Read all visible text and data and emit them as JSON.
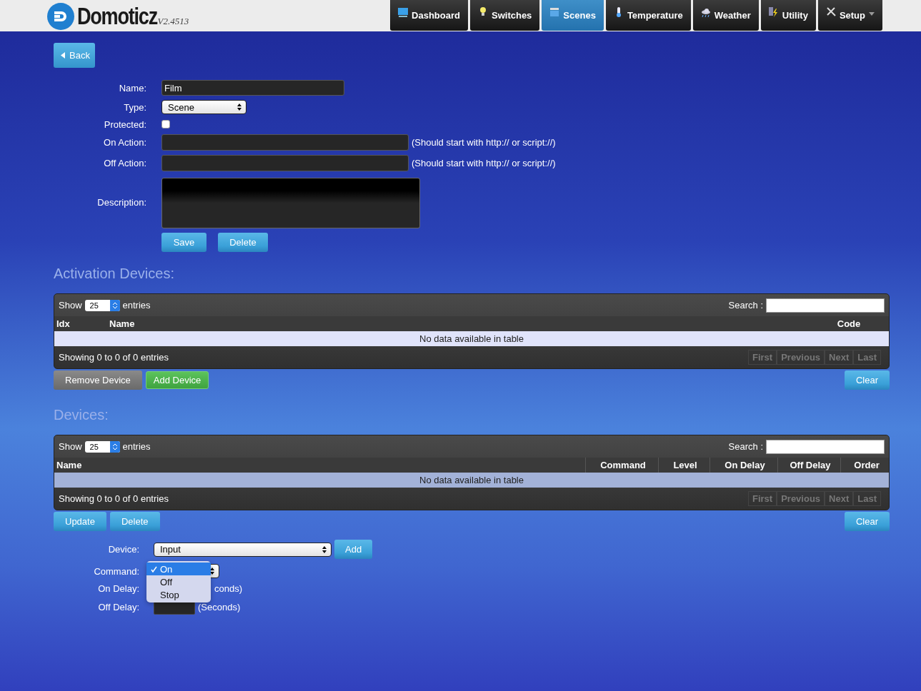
{
  "header": {
    "logo": {
      "name": "Domoticz",
      "version": "V2.4513"
    },
    "nav": [
      {
        "label": "Dashboard",
        "selected": false,
        "dropdown": false
      },
      {
        "label": "Switches",
        "selected": false,
        "dropdown": false
      },
      {
        "label": "Scenes",
        "selected": true,
        "dropdown": false
      },
      {
        "label": "Temperature",
        "selected": false,
        "dropdown": false
      },
      {
        "label": "Weather",
        "selected": false,
        "dropdown": false
      },
      {
        "label": "Utility",
        "selected": false,
        "dropdown": false
      },
      {
        "label": "Setup",
        "selected": false,
        "dropdown": true
      }
    ]
  },
  "back_button": "Back",
  "scene_form": {
    "fields": [
      {
        "label": "Name:",
        "kind": "text",
        "value": "Film"
      },
      {
        "label": "Type:",
        "kind": "select",
        "value": "Scene"
      },
      {
        "label": "Protected:",
        "kind": "checkbox",
        "checked": false
      },
      {
        "label": "On Action:",
        "kind": "text",
        "hint": "(Should start with http:// or script://)"
      },
      {
        "label": "Off Action:",
        "kind": "text",
        "hint": "(Should start with http:// or script://)"
      },
      {
        "label": "Description:",
        "kind": "textarea"
      }
    ],
    "buttons": [
      "Save",
      "Delete"
    ]
  },
  "sections": [
    {
      "title": "Activation Devices:",
      "table": {
        "kind": "activation",
        "show_label": "Show",
        "length": "25",
        "entries_label": "entries",
        "search_label": "Search :",
        "columns": [
          "Idx",
          "Name",
          "Code"
        ],
        "empty_message": "No data available in table",
        "info": "Showing 0 to 0 of 0 entries",
        "pagination": [
          {
            "label": "First",
            "disabled": true
          },
          {
            "label": "Previous",
            "disabled": true
          },
          {
            "label": "Next",
            "disabled": true
          },
          {
            "label": "Last",
            "disabled": true
          }
        ]
      },
      "buttons": [
        {
          "label": "Remove Device",
          "kind": "grey"
        },
        {
          "label": "Add Device",
          "kind": "green"
        }
      ],
      "right_buttons": [
        {
          "label": "Clear",
          "kind": "blue"
        }
      ]
    },
    {
      "title": "Devices:",
      "table": {
        "kind": "devices",
        "show_label": "Show",
        "length": "25",
        "entries_label": "entries",
        "search_label": "Search :",
        "columns": [
          "Name",
          "Command",
          "Level",
          "On Delay",
          "Off Delay",
          "Order"
        ],
        "empty_message": "No data available in table",
        "info": "Showing 0 to 0 of 0 entries",
        "pagination": [
          {
            "label": "First",
            "disabled": true
          },
          {
            "label": "Previous",
            "disabled": true
          },
          {
            "label": "Next",
            "disabled": true
          },
          {
            "label": "Last",
            "disabled": true
          }
        ]
      },
      "buttons": [
        {
          "label": "Update",
          "kind": "blue"
        },
        {
          "label": "Delete",
          "kind": "blue"
        }
      ],
      "right_buttons": [
        {
          "label": "Clear",
          "kind": "blue"
        }
      ]
    }
  ],
  "device_form": {
    "device": {
      "label": "Device:",
      "value": "Input",
      "button": "Add"
    },
    "command": {
      "label": "Command:",
      "expanded": true,
      "options": [
        {
          "label": "On",
          "selected": true
        },
        {
          "label": "Off",
          "selected": false
        },
        {
          "label": "Stop",
          "selected": false
        }
      ]
    },
    "on_delay": {
      "label": "On Delay:",
      "suffix": "conds)"
    },
    "off_delay": {
      "label": "Off Delay:",
      "suffix": "(Seconds)"
    }
  }
}
